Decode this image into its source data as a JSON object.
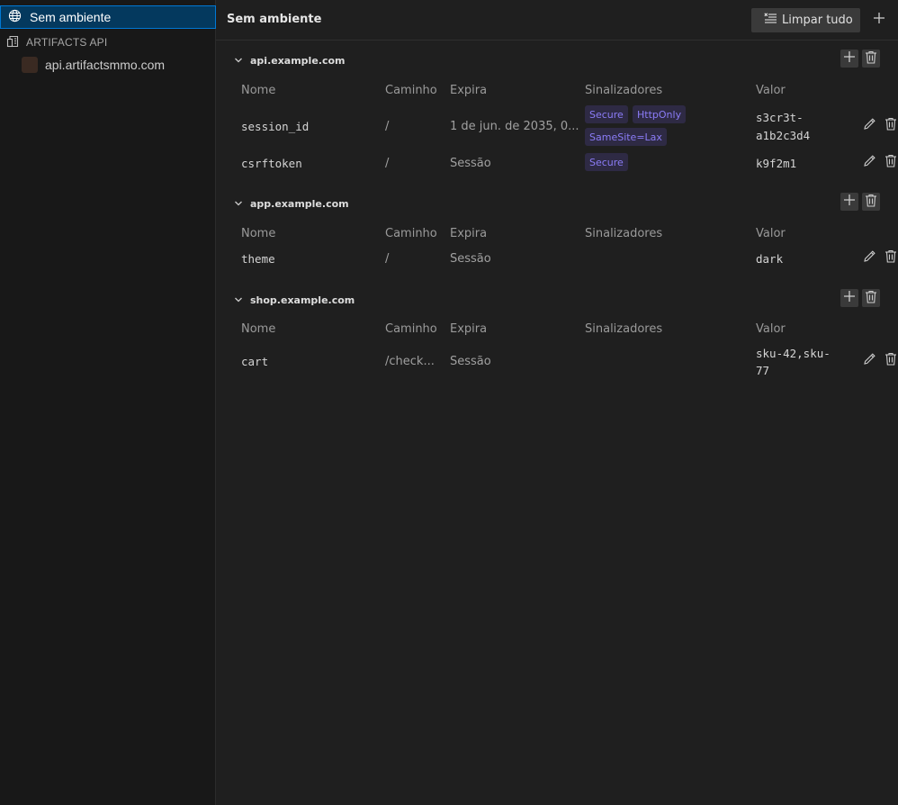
{
  "sidebar": {
    "active_item": {
      "label": "Sem ambiente",
      "icon": "globe-icon"
    },
    "section": {
      "label": "ARTIFACTS API",
      "icon": "environment-icon"
    },
    "sub_item": {
      "label": "api.artifactsmmo.com",
      "swatch_color": "#3a2a22"
    }
  },
  "header": {
    "title": "Sem ambiente",
    "clear_label": "Limpar tudo",
    "add_icon": "plus-icon"
  },
  "columns": {
    "name": "Nome",
    "path": "Caminho",
    "expires": "Expira",
    "flags": "Sinalizadores",
    "value": "Valor"
  },
  "groups": [
    {
      "domain": "api.example.com",
      "cookies": [
        {
          "name": "session_id",
          "path": "/",
          "expires": "1 de jun. de 2035, 0...",
          "flags": [
            "Secure",
            "HttpOnly",
            "SameSite=Lax"
          ],
          "value_line1": "s3cr3t-",
          "value_line2": "a1b2c3d4"
        },
        {
          "name": "csrftoken",
          "path": "/",
          "expires": "Sessão",
          "flags": [
            "Secure"
          ],
          "value_line1": "k9f2m1",
          "value_line2": ""
        }
      ]
    },
    {
      "domain": "app.example.com",
      "cookies": [
        {
          "name": "theme",
          "path": "/",
          "expires": "Sessão",
          "flags": [],
          "value_line1": "dark",
          "value_line2": ""
        }
      ]
    },
    {
      "domain": "shop.example.com",
      "cookies": [
        {
          "name": "cart",
          "path": "/check...",
          "expires": "Sessão",
          "flags": [],
          "value_line1": "sku-42,sku-",
          "value_line2": "77"
        }
      ]
    }
  ],
  "colors": {
    "accent": "#0078d4",
    "flag_text": "#8b7cf6",
    "flag_bg": "#2e2a44"
  }
}
